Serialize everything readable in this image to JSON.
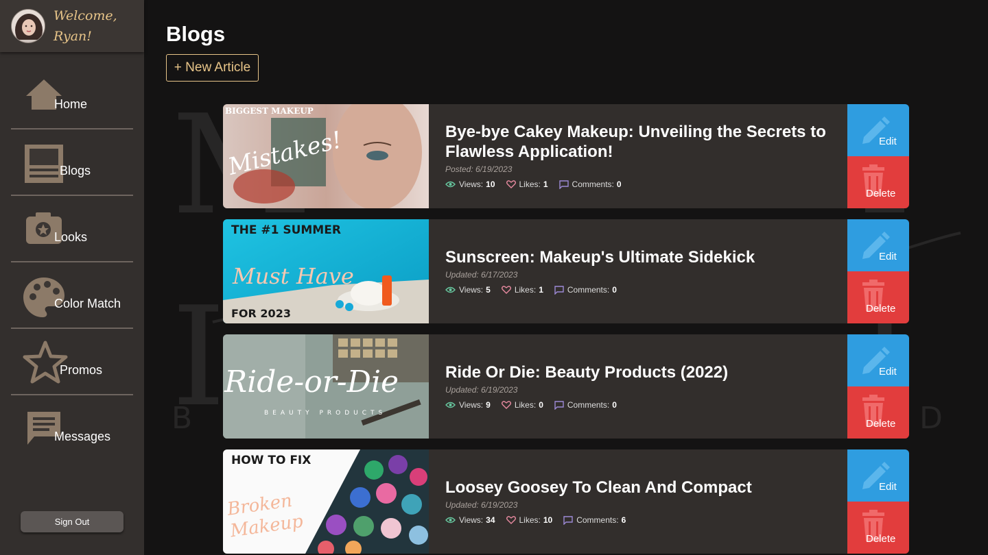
{
  "user": {
    "welcome": "Welcome,",
    "name": "Ryan!"
  },
  "nav": {
    "items": [
      {
        "label": "Home",
        "icon": "home-icon"
      },
      {
        "label": "Blogs",
        "icon": "blog-icon"
      },
      {
        "label": "Looks",
        "icon": "camera-icon"
      },
      {
        "label": "Color Match",
        "icon": "palette-icon"
      },
      {
        "label": "Promos",
        "icon": "star-icon"
      },
      {
        "label": "Messages",
        "icon": "message-icon"
      }
    ],
    "signout": "Sign Out"
  },
  "page": {
    "title": "Blogs",
    "new_article": "+ New Article"
  },
  "labels": {
    "views": "Views:",
    "likes": "Likes:",
    "comments": "Comments:",
    "edit": "Edit",
    "delete": "Delete"
  },
  "articles": [
    {
      "title": "Bye-bye Cakey Makeup: Unveiling the Secrets to Flawless Application!",
      "date": "Posted: 6/19/2023",
      "views": "10",
      "likes": "1",
      "comments": "0",
      "thumb": {
        "top": "BIGGEST MAKEUP",
        "script": "Mistakes!",
        "bottom": ""
      }
    },
    {
      "title": "Sunscreen: Makeup's Ultimate Sidekick",
      "date": "Updated: 6/17/2023",
      "views": "5",
      "likes": "1",
      "comments": "0",
      "thumb": {
        "top": "THE #1 SUMMER",
        "script": "Must Have",
        "bottom": "FOR 2023"
      }
    },
    {
      "title": "Ride Or Die: Beauty Products (2022)",
      "date": "Updated: 6/19/2023",
      "views": "9",
      "likes": "0",
      "comments": "0",
      "thumb": {
        "top": "",
        "script": "Ride-or-Die",
        "bottom": "BEAUTY PRODUCTS"
      }
    },
    {
      "title": "Loosey Goosey To Clean And Compact",
      "date": "Updated: 6/19/2023",
      "views": "34",
      "likes": "10",
      "comments": "6",
      "thumb": {
        "top": "HOW TO FIX",
        "script": "Broken Makeup",
        "bottom": ""
      }
    }
  ],
  "colors": {
    "accent": "#e8c589",
    "edit": "#2f9de0",
    "delete": "#e23d3d",
    "icon": "#8c7a68"
  }
}
